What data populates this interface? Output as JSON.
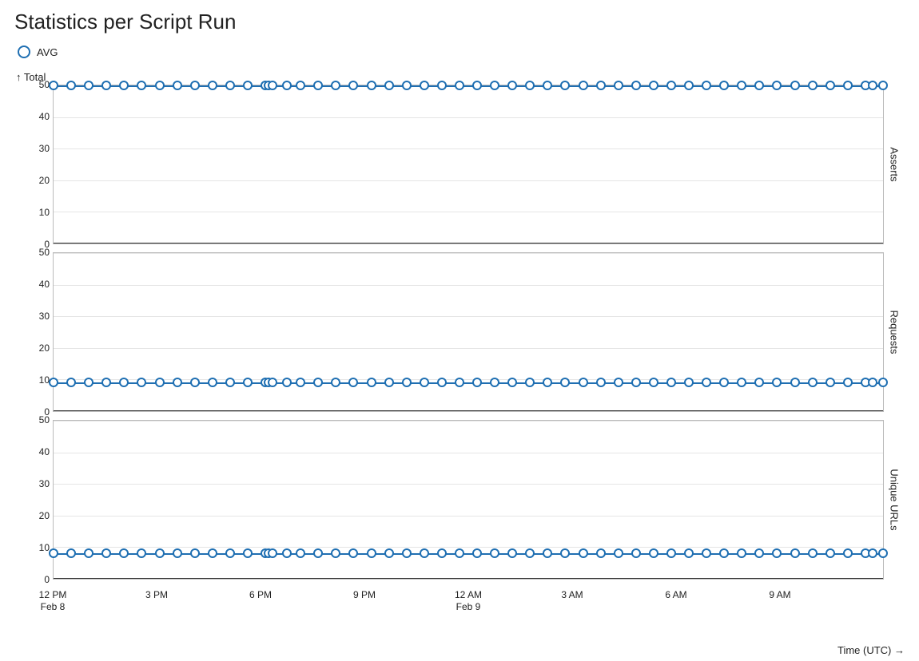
{
  "title": "Statistics per Script Run",
  "legend": {
    "series_label": "AVG",
    "color": "#1f6fb2"
  },
  "y_axis_title": "↑ Total",
  "x_axis_title": "Time (UTC) →",
  "panels": [
    {
      "name": "Asserts",
      "ymin": 0,
      "ymax": 50,
      "constant_value": 50
    },
    {
      "name": "Requests",
      "ymin": 0,
      "ymax": 50,
      "constant_value": 9
    },
    {
      "name": "Unique URLs",
      "ymin": 0,
      "ymax": 50,
      "constant_value": 8
    }
  ],
  "y_ticks": [
    50,
    40,
    30,
    20,
    10,
    0
  ],
  "x_ticks": [
    {
      "frac": 0.0,
      "label": "12 PM",
      "sub": "Feb 8"
    },
    {
      "frac": 0.125,
      "label": "3 PM",
      "sub": ""
    },
    {
      "frac": 0.25,
      "label": "6 PM",
      "sub": ""
    },
    {
      "frac": 0.375,
      "label": "9 PM",
      "sub": ""
    },
    {
      "frac": 0.5,
      "label": "12 AM",
      "sub": "Feb 9"
    },
    {
      "frac": 0.625,
      "label": "3 AM",
      "sub": ""
    },
    {
      "frac": 0.75,
      "label": "6 AM",
      "sub": ""
    },
    {
      "frac": 0.875,
      "label": "9 AM",
      "sub": ""
    }
  ],
  "x_range_hours": {
    "start": "Feb 8 12 PM",
    "end": "Feb 9 ~11:30 AM"
  },
  "chart_data": [
    {
      "type": "line",
      "title": "Asserts",
      "ylabel": "Total",
      "xlabel": "Time (UTC)",
      "ylim": [
        0,
        50
      ],
      "series": [
        {
          "name": "AVG",
          "x_hours_from_start": [
            0,
            0.5,
            1,
            1.5,
            2,
            2.5,
            3,
            3.5,
            4,
            4.5,
            5,
            5.5,
            6,
            6.1,
            6.2,
            6.6,
            7,
            7.5,
            8,
            8.5,
            9,
            9.5,
            10,
            10.5,
            11,
            11.5,
            12,
            12.5,
            13,
            13.5,
            14,
            14.5,
            15,
            15.5,
            16,
            16.5,
            17,
            17.5,
            18,
            18.5,
            19,
            19.5,
            20,
            20.5,
            21,
            21.5,
            22,
            22.5,
            23,
            23.2,
            23.5
          ],
          "y": [
            50,
            50,
            50,
            50,
            50,
            50,
            50,
            50,
            50,
            50,
            50,
            50,
            50,
            50,
            50,
            50,
            50,
            50,
            50,
            50,
            50,
            50,
            50,
            50,
            50,
            50,
            50,
            50,
            50,
            50,
            50,
            50,
            50,
            50,
            50,
            50,
            50,
            50,
            50,
            50,
            50,
            50,
            50,
            50,
            50,
            50,
            50,
            50,
            50,
            50,
            50
          ]
        }
      ]
    },
    {
      "type": "line",
      "title": "Requests",
      "ylabel": "Total",
      "xlabel": "Time (UTC)",
      "ylim": [
        0,
        50
      ],
      "series": [
        {
          "name": "AVG",
          "x_hours_from_start": [
            0,
            0.5,
            1,
            1.5,
            2,
            2.5,
            3,
            3.5,
            4,
            4.5,
            5,
            5.5,
            6,
            6.1,
            6.2,
            6.6,
            7,
            7.5,
            8,
            8.5,
            9,
            9.5,
            10,
            10.5,
            11,
            11.5,
            12,
            12.5,
            13,
            13.5,
            14,
            14.5,
            15,
            15.5,
            16,
            16.5,
            17,
            17.5,
            18,
            18.5,
            19,
            19.5,
            20,
            20.5,
            21,
            21.5,
            22,
            22.5,
            23,
            23.2,
            23.5
          ],
          "y": [
            9,
            9,
            9,
            9,
            9,
            9,
            9,
            9,
            9,
            9,
            9,
            9,
            9,
            9,
            9,
            9,
            9,
            9,
            9,
            9,
            9,
            9,
            9,
            9,
            9,
            9,
            9,
            9,
            9,
            9,
            9,
            9,
            9,
            9,
            9,
            9,
            9,
            9,
            9,
            9,
            9,
            9,
            9,
            9,
            9,
            9,
            9,
            9,
            9,
            9,
            9
          ]
        }
      ]
    },
    {
      "type": "line",
      "title": "Unique URLs",
      "ylabel": "Total",
      "xlabel": "Time (UTC)",
      "ylim": [
        0,
        50
      ],
      "series": [
        {
          "name": "AVG",
          "x_hours_from_start": [
            0,
            0.5,
            1,
            1.5,
            2,
            2.5,
            3,
            3.5,
            4,
            4.5,
            5,
            5.5,
            6,
            6.1,
            6.2,
            6.6,
            7,
            7.5,
            8,
            8.5,
            9,
            9.5,
            10,
            10.5,
            11,
            11.5,
            12,
            12.5,
            13,
            13.5,
            14,
            14.5,
            15,
            15.5,
            16,
            16.5,
            17,
            17.5,
            18,
            18.5,
            19,
            19.5,
            20,
            20.5,
            21,
            21.5,
            22,
            22.5,
            23,
            23.2,
            23.5
          ],
          "y": [
            8,
            8,
            8,
            8,
            8,
            8,
            8,
            8,
            8,
            8,
            8,
            8,
            8,
            8,
            8,
            8,
            8,
            8,
            8,
            8,
            8,
            8,
            8,
            8,
            8,
            8,
            8,
            8,
            8,
            8,
            8,
            8,
            8,
            8,
            8,
            8,
            8,
            8,
            8,
            8,
            8,
            8,
            8,
            8,
            8,
            8,
            8,
            8,
            8,
            8,
            8
          ]
        }
      ]
    }
  ]
}
